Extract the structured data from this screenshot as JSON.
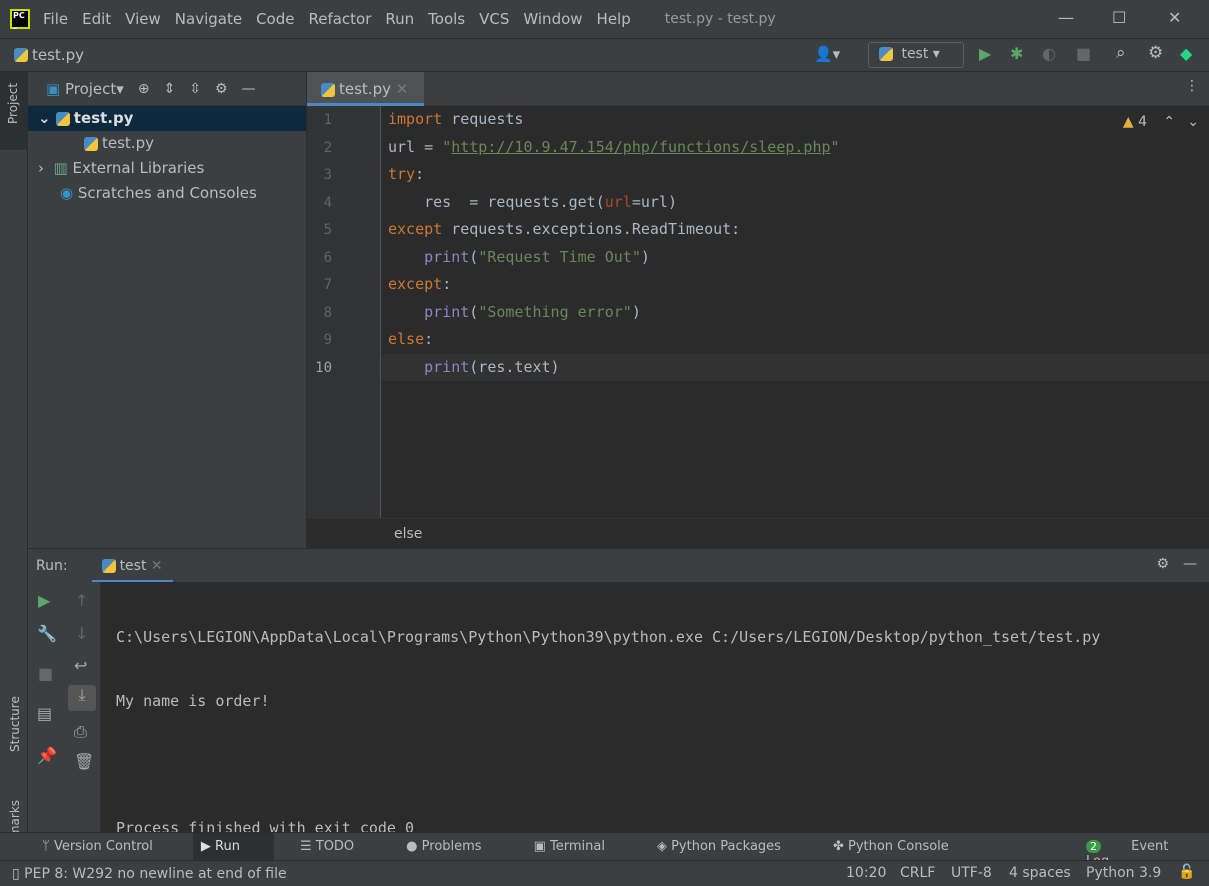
{
  "title_bar": {
    "menu": [
      "File",
      "Edit",
      "View",
      "Navigate",
      "Code",
      "Refactor",
      "Run",
      "Tools",
      "VCS",
      "Window",
      "Help"
    ],
    "window_title": "test.py - test.py"
  },
  "nav_bar": {
    "file": "test.py",
    "run_config": "test"
  },
  "left_strip": {
    "project": "Project",
    "structure": "Structure",
    "bookmarks": "Bookmarks"
  },
  "project_panel": {
    "title": "Project",
    "tree": [
      {
        "label": "test.py",
        "bold": true
      },
      {
        "label": "test.py"
      },
      {
        "label": "External Libraries"
      },
      {
        "label": "Scratches and Consoles"
      }
    ]
  },
  "editor": {
    "tab": "test.py",
    "warnings": "4",
    "breadcrumb": "else",
    "current_line": 10,
    "lines": [
      [
        [
          "kw",
          "import"
        ],
        [
          "tx",
          " requests"
        ]
      ],
      [
        [
          "tx",
          "url = "
        ],
        [
          "st",
          "\""
        ],
        [
          "url",
          "http://10.9.47.154/php/functions/sleep.php"
        ],
        [
          "st",
          "\""
        ]
      ],
      [
        [
          "kw",
          "try"
        ],
        [
          "tx",
          ":"
        ]
      ],
      [
        [
          "tx",
          "    res  = requests.get("
        ],
        [
          "pa",
          "url"
        ],
        [
          "tx",
          "=url)"
        ]
      ],
      [
        [
          "kw",
          "except"
        ],
        [
          "tx",
          " requests.exceptions.ReadTimeout:"
        ]
      ],
      [
        [
          "bi",
          "    print"
        ],
        [
          "tx",
          "("
        ],
        [
          "st",
          "\"Request Time Out\""
        ],
        [
          "tx",
          ")"
        ]
      ],
      [
        [
          "kw",
          "except"
        ],
        [
          "tx",
          ":"
        ]
      ],
      [
        [
          "bi",
          "    print"
        ],
        [
          "tx",
          "("
        ],
        [
          "st",
          "\"Something error\""
        ],
        [
          "tx",
          ")"
        ]
      ],
      [
        [
          "kw",
          "else"
        ],
        [
          "tx",
          ":"
        ]
      ],
      [
        [
          "bi",
          "    print"
        ],
        [
          "tx",
          "(res.text)"
        ]
      ]
    ]
  },
  "run_panel": {
    "label": "Run:",
    "tab": "test",
    "output": [
      "C:\\Users\\LEGION\\AppData\\Local\\Programs\\Python\\Python39\\python.exe C:/Users/LEGION/Desktop/python_tset/test.py",
      "My name is order!",
      "",
      "Process finished with exit code 0"
    ]
  },
  "bottom_bar": {
    "items": [
      "Version Control",
      "Run",
      "TODO",
      "Problems",
      "Terminal",
      "Python Packages",
      "Python Console"
    ],
    "event_log": "Event Log",
    "event_count": "2"
  },
  "status_bar": {
    "message": "PEP 8: W292 no newline at end of file",
    "position": "10:20",
    "line_sep": "CRLF",
    "encoding": "UTF-8",
    "indent": "4 spaces",
    "interpreter": "Python 3.9"
  }
}
